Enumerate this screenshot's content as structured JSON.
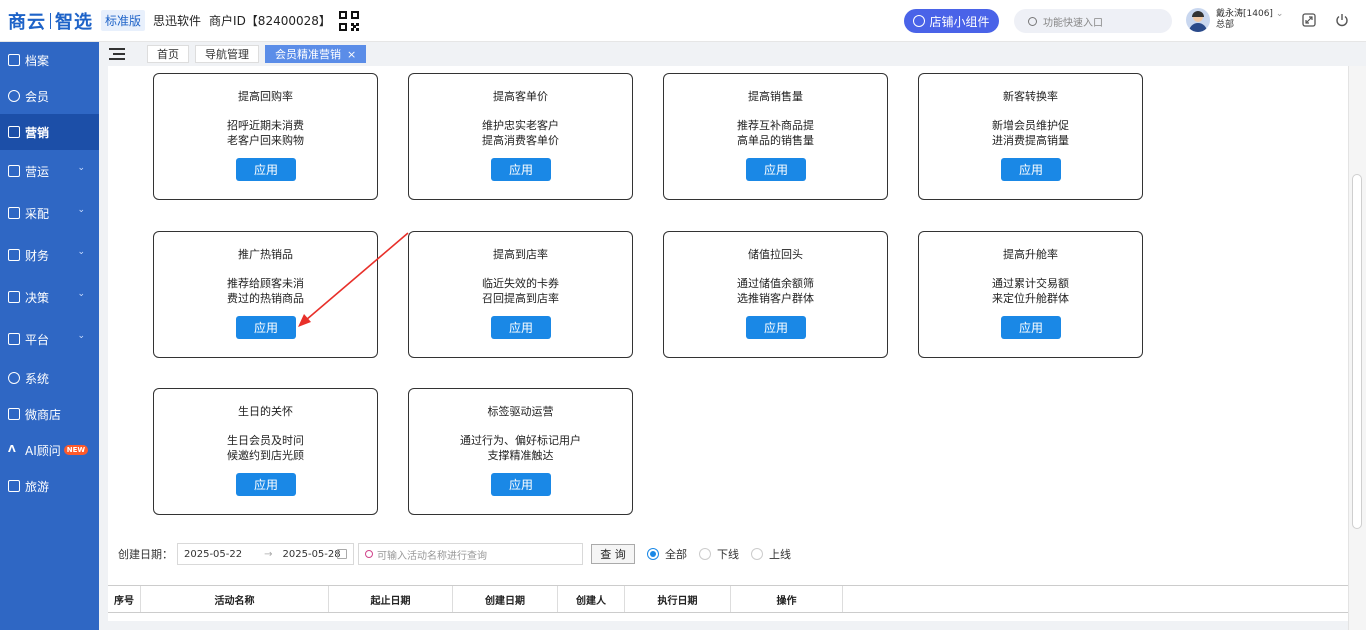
{
  "header": {
    "logo_part1": "商云",
    "logo_part2": "智选",
    "edition": "标准版",
    "company": "思迅软件",
    "merchant": "商户ID【82400028】",
    "shop_widget": "店铺小组件",
    "search_placeholder": "功能快速入口",
    "user_name": "戴永涛[1406]",
    "user_dept": "总部"
  },
  "sidebar": {
    "items": [
      {
        "label": "档案",
        "icon": "archive-icon",
        "has_chevron": false
      },
      {
        "label": "会员",
        "icon": "member-icon",
        "has_chevron": false
      },
      {
        "label": "营销",
        "icon": "marketing-icon",
        "has_chevron": false,
        "active": true
      },
      {
        "label": "营运",
        "icon": "operation-icon",
        "has_chevron": true
      },
      {
        "label": "采配",
        "icon": "purchase-icon",
        "has_chevron": true
      },
      {
        "label": "财务",
        "icon": "finance-icon",
        "has_chevron": true
      },
      {
        "label": "决策",
        "icon": "decision-icon",
        "has_chevron": true
      },
      {
        "label": "平台",
        "icon": "platform-icon",
        "has_chevron": true
      },
      {
        "label": "系统",
        "icon": "system-icon",
        "has_chevron": false
      },
      {
        "label": "微商店",
        "icon": "microstore-icon",
        "has_chevron": false
      },
      {
        "label": "AI顾问",
        "icon": "ai-icon",
        "has_chevron": false,
        "badge": "NEW"
      },
      {
        "label": "旅游",
        "icon": "travel-icon",
        "has_chevron": false
      }
    ]
  },
  "tabs": [
    {
      "label": "首页"
    },
    {
      "label": "导航管理"
    },
    {
      "label": "会员精准营销",
      "active": true
    }
  ],
  "cards": [
    {
      "title": "提高回购率",
      "desc1": "招呼近期未消费",
      "desc2": "老客户回来购物",
      "button": "应用"
    },
    {
      "title": "提高客单价",
      "desc1": "维护忠实老客户",
      "desc2": "提高消费客单价",
      "button": "应用"
    },
    {
      "title": "提高销售量",
      "desc1": "推荐互补商品提",
      "desc2": "高单品的销售量",
      "button": "应用"
    },
    {
      "title": "新客转换率",
      "desc1": "新增会员维护促",
      "desc2": "进消费提高销量",
      "button": "应用"
    },
    {
      "title": "推广热销品",
      "desc1": "推荐给顾客未消",
      "desc2": "费过的热销商品",
      "button": "应用"
    },
    {
      "title": "提高到店率",
      "desc1": "临近失效的卡券",
      "desc2": "召回提高到店率",
      "button": "应用"
    },
    {
      "title": "储值拉回头",
      "desc1": "通过储值余额筛",
      "desc2": "选推销客户群体",
      "button": "应用"
    },
    {
      "title": "提高升舱率",
      "desc1": "通过累计交易额",
      "desc2": "来定位升舱群体",
      "button": "应用"
    },
    {
      "title": "生日的关怀",
      "desc1": "生日会员及时问",
      "desc2": "候邀约到店光顾",
      "button": "应用"
    },
    {
      "title": "标签驱动运营",
      "desc1": "通过行为、偏好标记用户",
      "desc2": "支撑精准触达",
      "button": "应用"
    }
  ],
  "filter": {
    "created_label": "创建日期：",
    "start_date": "2025-05-22",
    "end_date": "2025-05-28",
    "search_placeholder": "可输入活动名称进行查询",
    "query_button": "查 询",
    "radio_all": "全部",
    "radio_offline": "下线",
    "radio_online": "上线"
  },
  "table": {
    "columns": [
      "序号",
      "活动名称",
      "起止日期",
      "创建日期",
      "创建人",
      "执行日期",
      "操作"
    ]
  }
}
